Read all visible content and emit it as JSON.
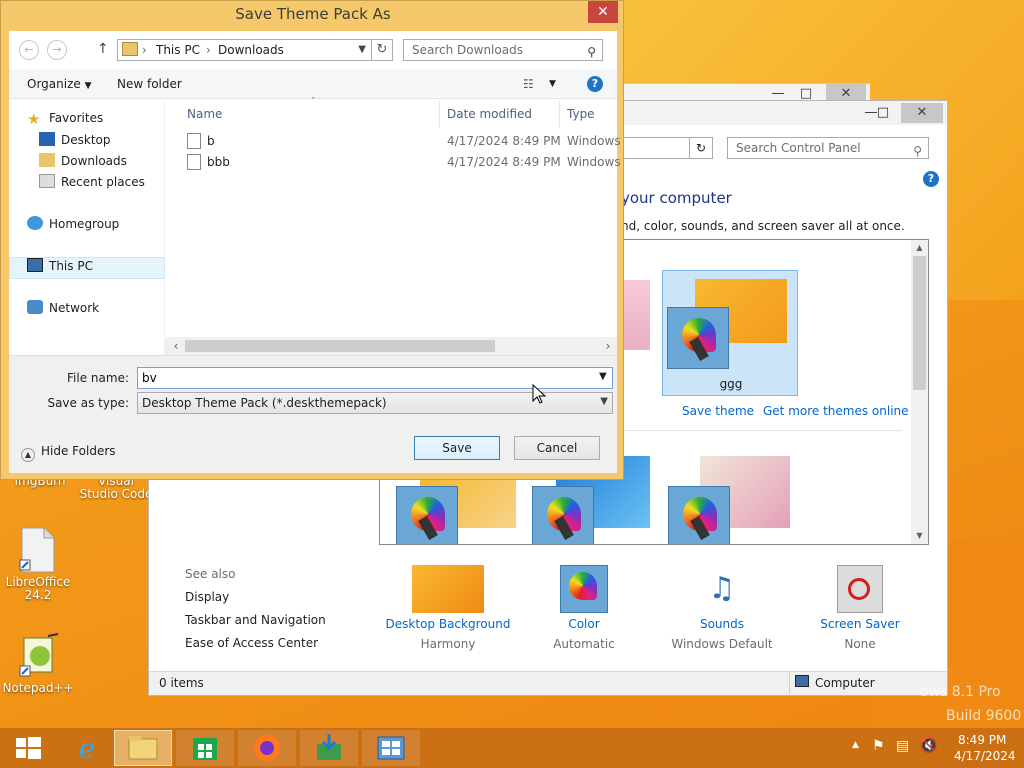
{
  "desktop": {
    "icons": [
      {
        "label": "ImgBurn"
      },
      {
        "label": "Visual Studio Code"
      },
      {
        "label": "LibreOffice 24.2"
      },
      {
        "label": "Notepad++"
      }
    ],
    "watermark_line1": "ows 8.1 Pro",
    "watermark_line2": "Build 9600"
  },
  "control_panel": {
    "search_placeholder": "Search Control Panel",
    "heading": "your computer",
    "description": "nd, color, sounds, and screen saver all at once.",
    "selected_theme": "ggg",
    "save_theme_link": "Save theme",
    "more_themes_link": "Get more themes online",
    "see_also": {
      "heading": "See also",
      "links": [
        "Display",
        "Taskbar and Navigation",
        "Ease of Access Center"
      ]
    },
    "bottom_items": [
      {
        "name": "Desktop Background",
        "sub": "Harmony"
      },
      {
        "name": "Color",
        "sub": "Automatic"
      },
      {
        "name": "Sounds",
        "sub": "Windows Default"
      },
      {
        "name": "Screen Saver",
        "sub": "None"
      }
    ],
    "status_left": "0 items",
    "status_right": "Computer"
  },
  "dialog": {
    "title": "Save Theme Pack As",
    "breadcrumb": [
      "This PC",
      "Downloads"
    ],
    "search_placeholder": "Search Downloads",
    "toolbar": {
      "organize": "Organize",
      "new_folder": "New folder"
    },
    "nav": {
      "favorites": "Favorites",
      "desktop": "Desktop",
      "downloads": "Downloads",
      "recent": "Recent places",
      "homegroup": "Homegroup",
      "thispc": "This PC",
      "network": "Network"
    },
    "columns": {
      "name": "Name",
      "date": "Date modified",
      "type": "Type"
    },
    "files": [
      {
        "name": "b",
        "date": "4/17/2024 8:49 PM",
        "type": "Windows"
      },
      {
        "name": "bbb",
        "date": "4/17/2024 8:49 PM",
        "type": "Windows"
      }
    ],
    "file_name_label": "File name:",
    "file_name_value": "bv",
    "save_as_type_label": "Save as type:",
    "save_as_type_value": "Desktop Theme Pack (*.deskthemepack)",
    "hide_folders": "Hide Folders",
    "save_button": "Save",
    "cancel_button": "Cancel"
  },
  "taskbar": {
    "time": "8:49 PM",
    "date": "4/17/2024"
  }
}
